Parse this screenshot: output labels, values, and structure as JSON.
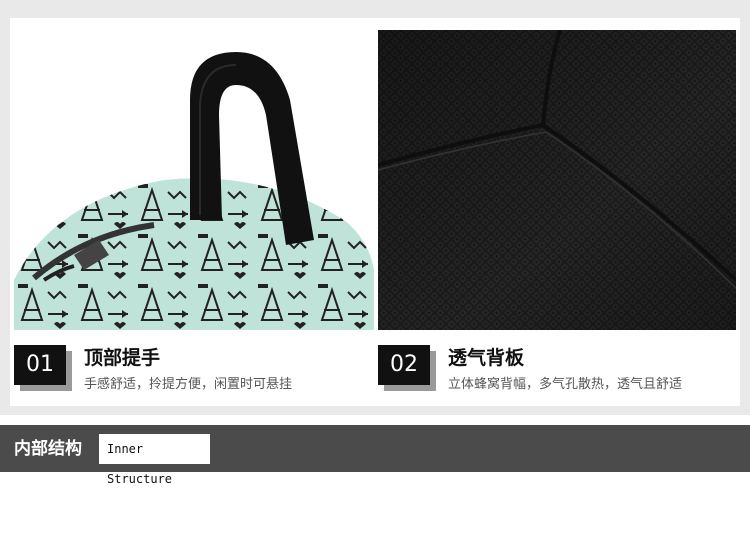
{
  "features": [
    {
      "number": "01",
      "title": "顶部提手",
      "description": "手感舒适，拎提方便，闲置时可悬挂"
    },
    {
      "number": "02",
      "title": "透气背板",
      "description": "立体蜂窝背幅，多气孔散热，透气且舒适"
    }
  ],
  "section": {
    "title_cn": "内部结构",
    "title_en": "Inner Structure"
  },
  "colors": {
    "frame_background": "#e9e9e9",
    "number_box": "#111111",
    "section_bar": "#4b4b4b",
    "bag_print_mint": "#bfe3d8",
    "mesh_black": "#1b1b1b"
  }
}
